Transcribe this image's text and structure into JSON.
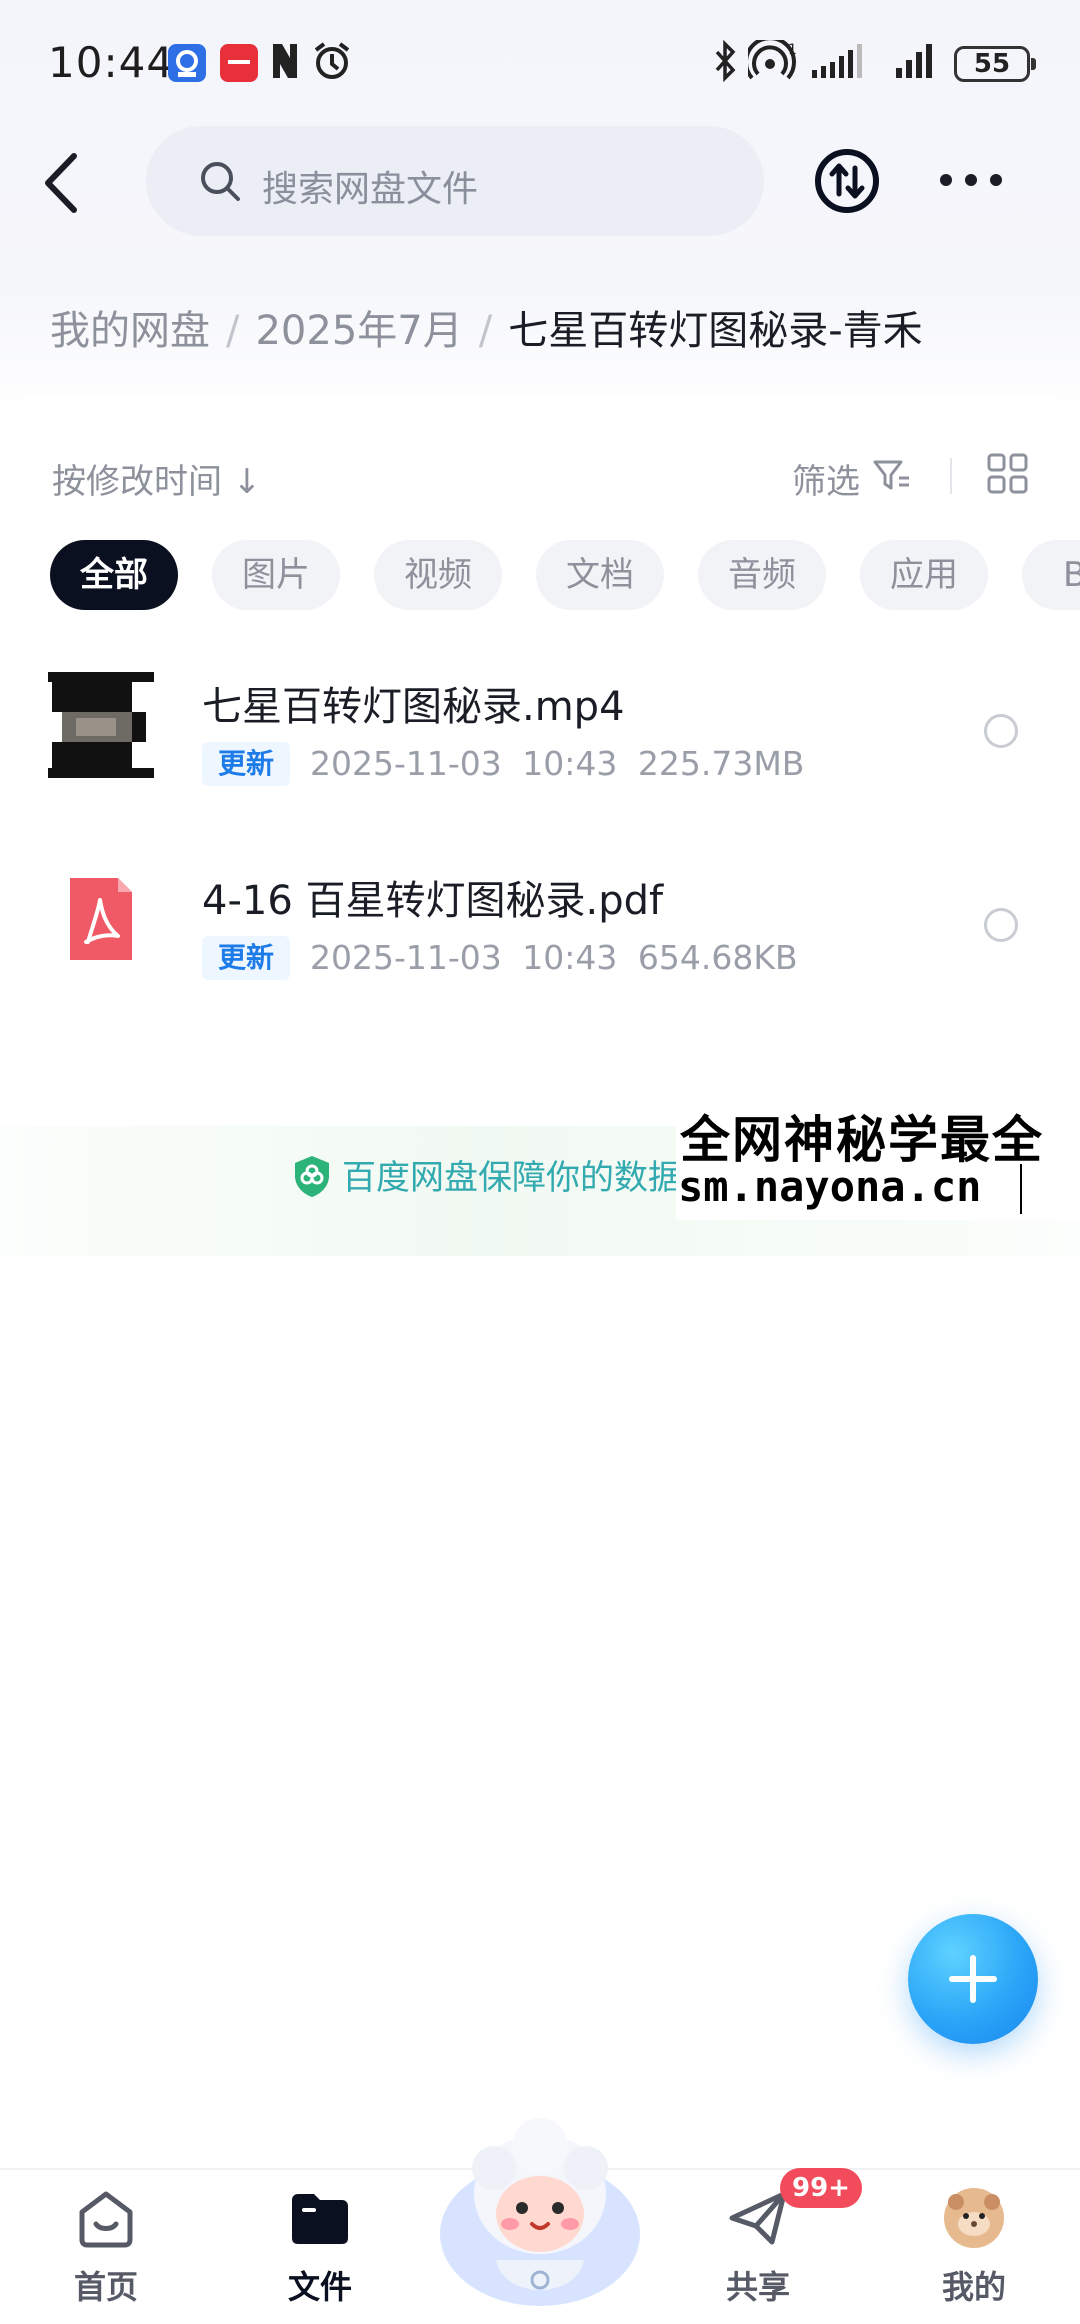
{
  "status_bar": {
    "time": "10:44",
    "battery": "55"
  },
  "header": {
    "search_placeholder": "搜索网盘文件"
  },
  "breadcrumb": {
    "items": [
      "我的网盘",
      "2025年7月",
      "七星百转灯图秘录-青禾"
    ],
    "separator": "/"
  },
  "toolbar": {
    "sort_label": "按修改时间 ↓",
    "filter_label": "筛选"
  },
  "chips": [
    "全部",
    "图片",
    "视频",
    "文档",
    "音频",
    "应用",
    "BT"
  ],
  "files": [
    {
      "name": "七星百转灯图秘录.mp4",
      "badge": "更新",
      "meta": "2025-11-03  10:43  225.73MB",
      "icon": "video-thumbnail"
    },
    {
      "name": "4-16 百星转灯图秘录.pdf",
      "badge": "更新",
      "meta": "2025-11-03  10:43  654.68KB",
      "icon": "pdf-icon"
    }
  ],
  "assurance": {
    "text": "百度网盘保障你的数据"
  },
  "watermark": {
    "line1": "全网神秘学最全",
    "line2": "sm.nayona.cn"
  },
  "bottom_nav": {
    "items": [
      {
        "label": "首页"
      },
      {
        "label": "文件"
      },
      {
        "label": "共享"
      },
      {
        "label": "我的"
      }
    ],
    "share_badge": "99+"
  },
  "colors": {
    "accent_blue": "#1e7ce8",
    "active_chip": "#0b1020",
    "badge_red": "#f24b5b",
    "pdf_red": "#f05a66"
  }
}
